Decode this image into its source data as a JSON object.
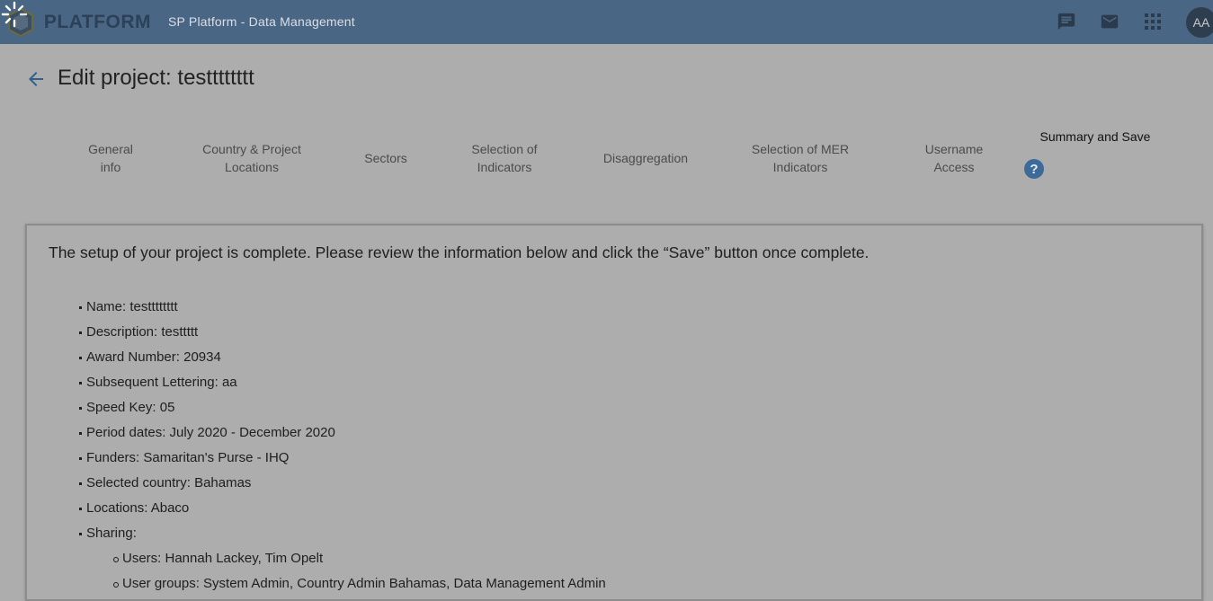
{
  "header": {
    "logo_text": "PLATFORM",
    "app_title": "SP Platform - Data Management",
    "icons": [
      "chat-icon",
      "mail-icon",
      "apps-grid-icon"
    ],
    "avatar_initials": "AA",
    "colors": {
      "bar": "#4a6685",
      "logo_text": "#2c4056",
      "avatar": "#2f3e4e"
    }
  },
  "page": {
    "title": "Edit project: testttttttt"
  },
  "stepper": {
    "steps": [
      {
        "line1": "General",
        "line2": "info"
      },
      {
        "line1": "Country & Project",
        "line2": "Locations"
      },
      {
        "line1": "Sectors",
        "line2": ""
      },
      {
        "line1": "Selection of",
        "line2": "Indicators"
      },
      {
        "line1": "Disaggregation",
        "line2": ""
      },
      {
        "line1": "Selection of MER",
        "line2": "Indicators"
      },
      {
        "line1": "Username",
        "line2": "Access"
      },
      {
        "line1": "Summary and Save",
        "line2": ""
      }
    ],
    "active_step": "Summary and Save",
    "help_symbol": "?"
  },
  "summary": {
    "intro": "The setup of your project is complete. Please review the information below and click the “Save” button once complete.",
    "items": [
      "Name: testttttttt",
      "Description: testtttt",
      "Award Number: 20934",
      "Subsequent Lettering: aa",
      "Speed Key: 05",
      "Period dates: July 2020 - December 2020",
      "Funders: Samaritan's Purse - IHQ",
      "Selected country: Bahamas",
      "Locations: Abaco",
      "Sharing:"
    ],
    "sharing": [
      "Users: Hannah Lackey, Tim Opelt",
      "User groups: System Admin, Country Admin Bahamas, Data Management Admin"
    ]
  }
}
